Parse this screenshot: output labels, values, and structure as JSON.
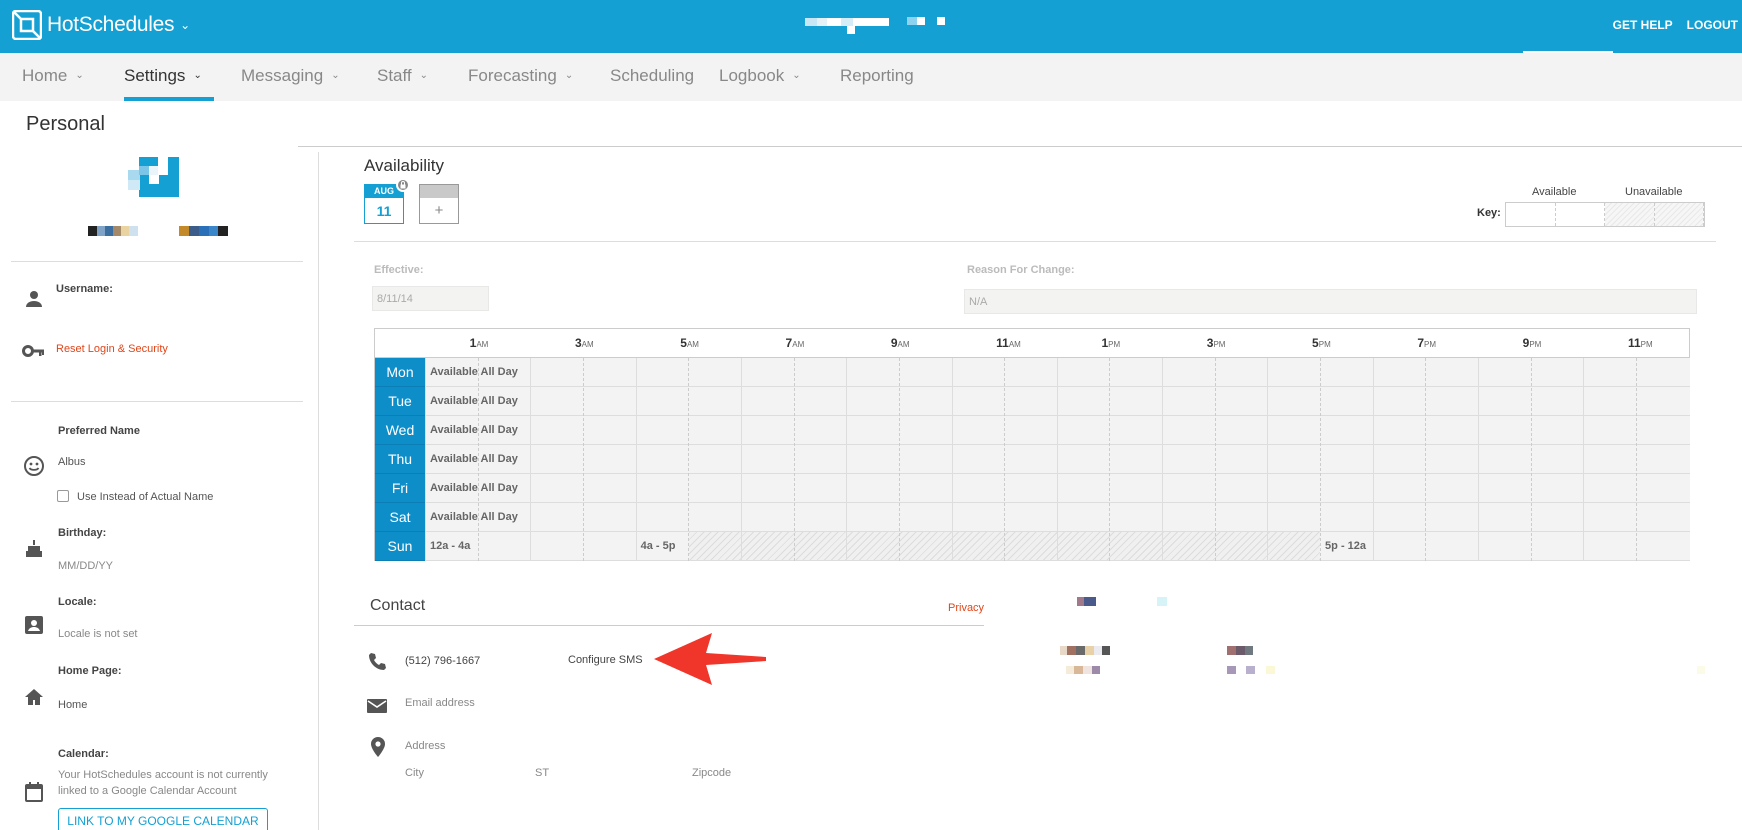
{
  "app": {
    "name": "HotSchedules"
  },
  "topbar": {
    "help": "GET HELP",
    "logout": "LOGOUT"
  },
  "nav": {
    "items": [
      {
        "label": "Home"
      },
      {
        "label": "Settings"
      },
      {
        "label": "Messaging"
      },
      {
        "label": "Staff"
      },
      {
        "label": "Forecasting"
      },
      {
        "label": "Scheduling"
      },
      {
        "label": "Logbook"
      },
      {
        "label": "Reporting"
      }
    ],
    "active": "Settings"
  },
  "page": {
    "title": "Personal"
  },
  "sidebar": {
    "username_label": "Username:",
    "reset_link": "Reset Login & Security",
    "preferred_name_label": "Preferred Name",
    "preferred_name_value": "Albus",
    "use_instead_label": "Use Instead of Actual Name",
    "birthday_label": "Birthday:",
    "birthday_placeholder": "MM/DD/YY",
    "locale_label": "Locale:",
    "locale_value": "Locale is not set",
    "home_page_label": "Home Page:",
    "home_page_value": "Home",
    "calendar_label": "Calendar:",
    "calendar_note_1": "Your HotSchedules account is not currently",
    "calendar_note_2": "linked to a Google Calendar Account",
    "calendar_button": "LINK TO MY GOOGLE CALENDAR"
  },
  "availability": {
    "title": "Availability",
    "tile_month": "AUG",
    "tile_day": "11",
    "add_symbol": "+",
    "key_label": "Key:",
    "key_available": "Available",
    "key_unavailable": "Unavailable",
    "effective_label": "Effective:",
    "effective_value": "8/11/14",
    "reason_label": "Reason For Change:",
    "reason_value": "N/A",
    "hours": [
      {
        "num": "1",
        "ap": "AM"
      },
      {
        "num": "3",
        "ap": "AM"
      },
      {
        "num": "5",
        "ap": "AM"
      },
      {
        "num": "7",
        "ap": "AM"
      },
      {
        "num": "9",
        "ap": "AM"
      },
      {
        "num": "11",
        "ap": "AM"
      },
      {
        "num": "1",
        "ap": "PM"
      },
      {
        "num": "3",
        "ap": "PM"
      },
      {
        "num": "5",
        "ap": "PM"
      },
      {
        "num": "7",
        "ap": "PM"
      },
      {
        "num": "9",
        "ap": "PM"
      },
      {
        "num": "11",
        "ap": "PM"
      }
    ],
    "days": [
      {
        "day": "Mon",
        "blocks": [
          "Available All Day"
        ]
      },
      {
        "day": "Tue",
        "blocks": [
          "Available All Day"
        ]
      },
      {
        "day": "Wed",
        "blocks": [
          "Available All Day"
        ]
      },
      {
        "day": "Thu",
        "blocks": [
          "Available All Day"
        ]
      },
      {
        "day": "Fri",
        "blocks": [
          "Available All Day"
        ]
      },
      {
        "day": "Sat",
        "blocks": [
          "Available All Day"
        ]
      },
      {
        "day": "Sun",
        "blocks": [
          "12a - 4a",
          "4a - 5p",
          "5p - 12a"
        ]
      }
    ]
  },
  "contact": {
    "title": "Contact",
    "privacy": "Privacy",
    "phone": "(512) 796-1667",
    "configure_sms": "Configure SMS",
    "email_placeholder": "Email address",
    "address_placeholder": "Address",
    "city_placeholder": "City",
    "state_placeholder": "ST",
    "zip_placeholder": "Zipcode"
  }
}
